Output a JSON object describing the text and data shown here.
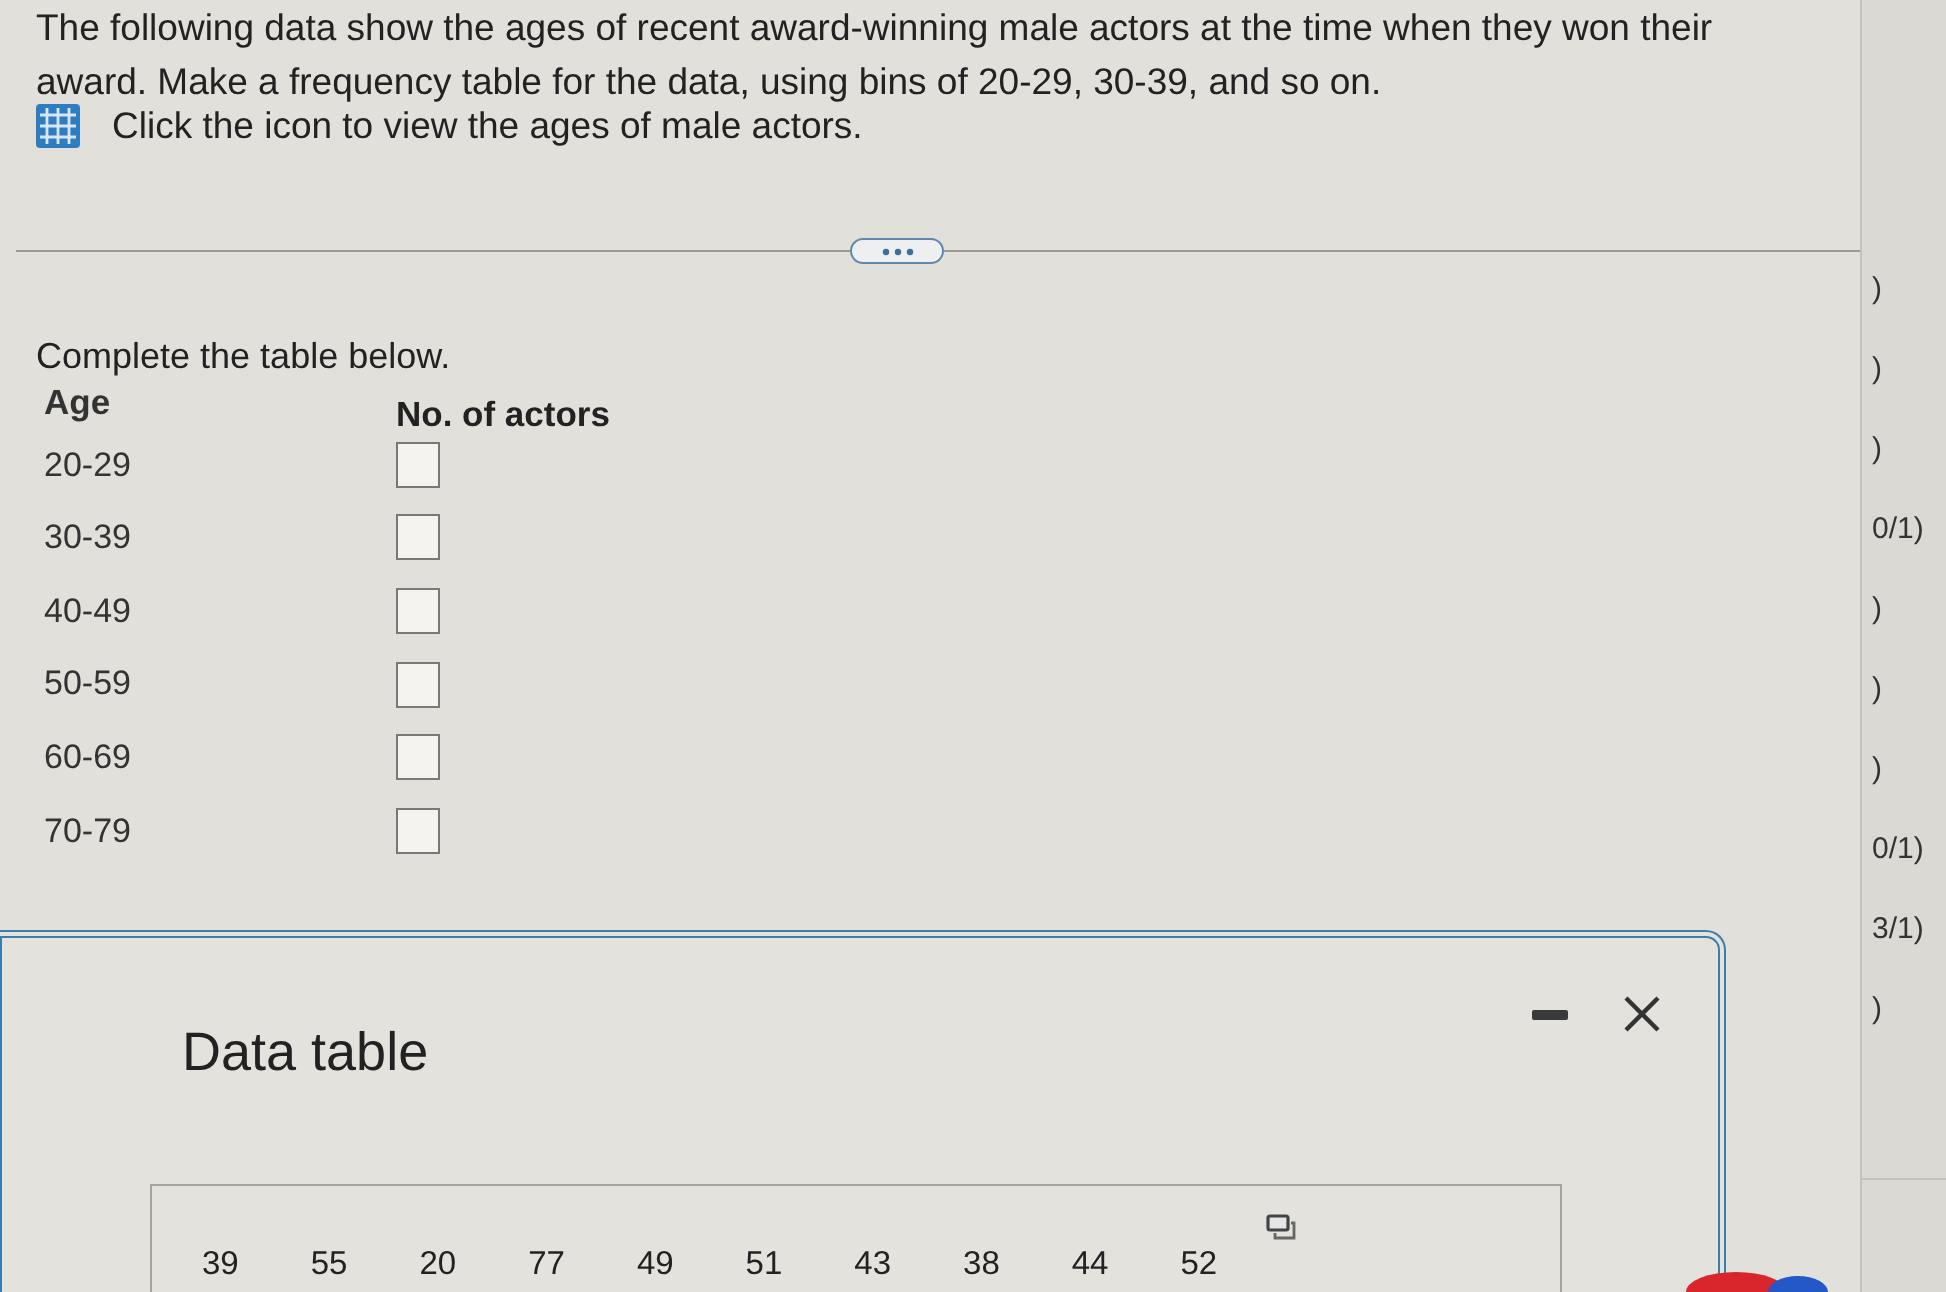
{
  "question": {
    "text": "The following data show the ages of recent award-winning male actors at the time when they won their award. Make a frequency table for the data, using bins of 20-29, 30-39, and so on.",
    "hint": "Click the icon to view the ages of male actors."
  },
  "prompt": "Complete the table below.",
  "frequency_table": {
    "columns": [
      "Age",
      "No. of actors"
    ],
    "rows": [
      {
        "age": "20-29"
      },
      {
        "age": "30-39"
      },
      {
        "age": "40-49"
      },
      {
        "age": "50-59"
      },
      {
        "age": "60-69"
      },
      {
        "age": "70-79"
      }
    ]
  },
  "data_table_window": {
    "title": "Data table",
    "values": [
      "39",
      "55",
      "20",
      "77",
      "49",
      "51",
      "43",
      "38",
      "44",
      "52"
    ]
  },
  "score_list": [
    ")",
    ")",
    ")",
    "0/1)",
    ")",
    ")",
    ")",
    "0/1)",
    "3/1)",
    ")"
  ]
}
